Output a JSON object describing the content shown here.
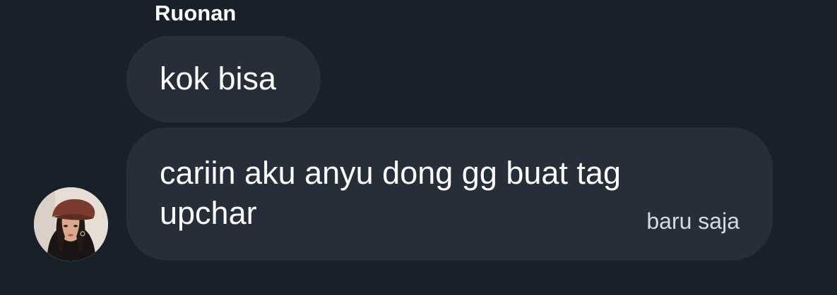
{
  "conversation": {
    "sender_name": "Ruonan",
    "messages": [
      {
        "text": "kok bisa"
      },
      {
        "text": "cariin aku anyu dong gg buat tag\nupchar",
        "timestamp": "baru saja"
      }
    ]
  },
  "colors": {
    "background": "#18202a",
    "bubble": "#262f39",
    "text": "#ffffff",
    "timestamp": "#d7dbe0"
  }
}
